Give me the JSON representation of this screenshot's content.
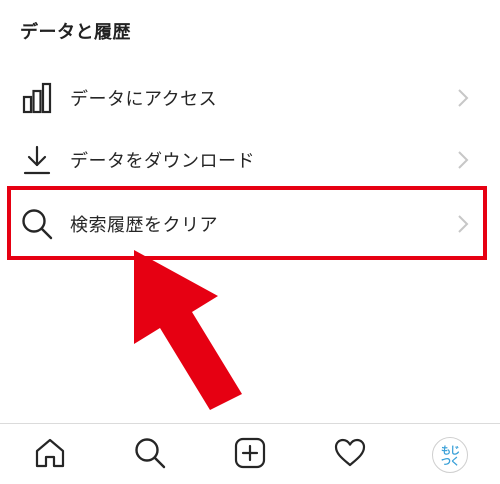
{
  "section": {
    "title": "データと履歴"
  },
  "menu": {
    "items": [
      {
        "label": "データにアクセス",
        "icon": "bar-chart-icon"
      },
      {
        "label": "データをダウンロード",
        "icon": "download-icon"
      },
      {
        "label": "検索履歴をクリア",
        "icon": "search-icon"
      }
    ]
  },
  "bottom_nav": {
    "items": [
      {
        "icon": "home-icon"
      },
      {
        "icon": "search-icon"
      },
      {
        "icon": "add-post-icon"
      },
      {
        "icon": "heart-icon"
      },
      {
        "icon": "profile-avatar"
      }
    ]
  },
  "avatar": {
    "logo_text": "もじつく"
  },
  "colors": {
    "highlight": "#e60012",
    "text": "#262626",
    "chevron": "#c7c7c7"
  }
}
